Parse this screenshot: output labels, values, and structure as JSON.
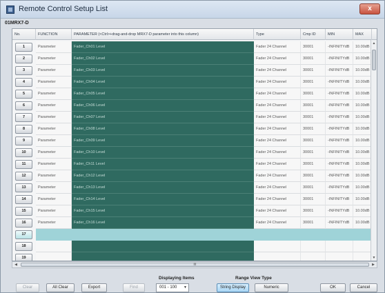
{
  "window": {
    "title": "Remote Control Setup List",
    "close_label": "x"
  },
  "device": "01MRX7-D",
  "columns": {
    "no": "No.",
    "function": "FUNCTION",
    "parameter": "PARAMETER (<Ctrl>+drag-and-drop MRX7-D parameter into this column)",
    "type": "Type",
    "cmp_id": "Cmp ID",
    "min": "MIN",
    "max": "MAX"
  },
  "rows": [
    {
      "no": "1",
      "function": "Parameter",
      "parameter": "Fader_Ch01 Level",
      "type": "Fader 24 Channel",
      "cmp_id": "30001",
      "min": "-INFINITYdB",
      "max": "10.00dB"
    },
    {
      "no": "2",
      "function": "Parameter",
      "parameter": "Fader_Ch02 Level",
      "type": "Fader 24 Channel",
      "cmp_id": "30001",
      "min": "-INFINITYdB",
      "max": "10.00dB"
    },
    {
      "no": "3",
      "function": "Parameter",
      "parameter": "Fader_Ch03 Level",
      "type": "Fader 24 Channel",
      "cmp_id": "30001",
      "min": "-INFINITYdB",
      "max": "10.00dB"
    },
    {
      "no": "4",
      "function": "Parameter",
      "parameter": "Fader_Ch04 Level",
      "type": "Fader 24 Channel",
      "cmp_id": "30001",
      "min": "-INFINITYdB",
      "max": "10.00dB"
    },
    {
      "no": "5",
      "function": "Parameter",
      "parameter": "Fader_Ch05 Level",
      "type": "Fader 24 Channel",
      "cmp_id": "30001",
      "min": "-INFINITYdB",
      "max": "10.00dB"
    },
    {
      "no": "6",
      "function": "Parameter",
      "parameter": "Fader_Ch06 Level",
      "type": "Fader 24 Channel",
      "cmp_id": "30001",
      "min": "-INFINITYdB",
      "max": "10.00dB"
    },
    {
      "no": "7",
      "function": "Parameter",
      "parameter": "Fader_Ch07 Level",
      "type": "Fader 24 Channel",
      "cmp_id": "30001",
      "min": "-INFINITYdB",
      "max": "10.00dB"
    },
    {
      "no": "8",
      "function": "Parameter",
      "parameter": "Fader_Ch08 Level",
      "type": "Fader 24 Channel",
      "cmp_id": "30001",
      "min": "-INFINITYdB",
      "max": "10.00dB"
    },
    {
      "no": "9",
      "function": "Parameter",
      "parameter": "Fader_Ch09 Level",
      "type": "Fader 24 Channel",
      "cmp_id": "30001",
      "min": "-INFINITYdB",
      "max": "10.00dB"
    },
    {
      "no": "10",
      "function": "Parameter",
      "parameter": "Fader_Ch10 Level",
      "type": "Fader 24 Channel",
      "cmp_id": "30001",
      "min": "-INFINITYdB",
      "max": "10.00dB"
    },
    {
      "no": "11",
      "function": "Parameter",
      "parameter": "Fader_Ch11 Level",
      "type": "Fader 24 Channel",
      "cmp_id": "30001",
      "min": "-INFINITYdB",
      "max": "10.00dB"
    },
    {
      "no": "12",
      "function": "Parameter",
      "parameter": "Fader_Ch12 Level",
      "type": "Fader 24 Channel",
      "cmp_id": "30001",
      "min": "-INFINITYdB",
      "max": "10.00dB"
    },
    {
      "no": "13",
      "function": "Parameter",
      "parameter": "Fader_Ch13 Level",
      "type": "Fader 24 Channel",
      "cmp_id": "30001",
      "min": "-INFINITYdB",
      "max": "10.00dB"
    },
    {
      "no": "14",
      "function": "Parameter",
      "parameter": "Fader_Ch14 Level",
      "type": "Fader 24 Channel",
      "cmp_id": "30001",
      "min": "-INFINITYdB",
      "max": "10.00dB"
    },
    {
      "no": "15",
      "function": "Parameter",
      "parameter": "Fader_Ch15 Level",
      "type": "Fader 24 Channel",
      "cmp_id": "30001",
      "min": "-INFINITYdB",
      "max": "10.00dB"
    },
    {
      "no": "16",
      "function": "Parameter",
      "parameter": "Fader_Ch16 Level",
      "type": "Fader 24 Channel",
      "cmp_id": "30001",
      "min": "-INFINITYdB",
      "max": "10.00dB"
    },
    {
      "no": "17",
      "function": "",
      "parameter": "",
      "type": "",
      "cmp_id": "",
      "min": "",
      "max": "",
      "selected": true
    },
    {
      "no": "18",
      "function": "",
      "parameter": "",
      "type": "",
      "cmp_id": "",
      "min": "",
      "max": ""
    },
    {
      "no": "19",
      "function": "",
      "parameter": "",
      "type": "",
      "cmp_id": "",
      "min": "",
      "max": ""
    }
  ],
  "hscroll_grip": "III",
  "bottom": {
    "displaying_items_label": "Displaying Items",
    "displaying_items_value": "001 - 100",
    "range_view_type_label": "Range View Type",
    "buttons": {
      "clear": "Clear",
      "all_clear": "All Clear",
      "export": "Export",
      "find": "Find",
      "string_display": "String Display",
      "numeric": "Numeric",
      "ok": "OK",
      "cancel": "Cancel"
    }
  }
}
